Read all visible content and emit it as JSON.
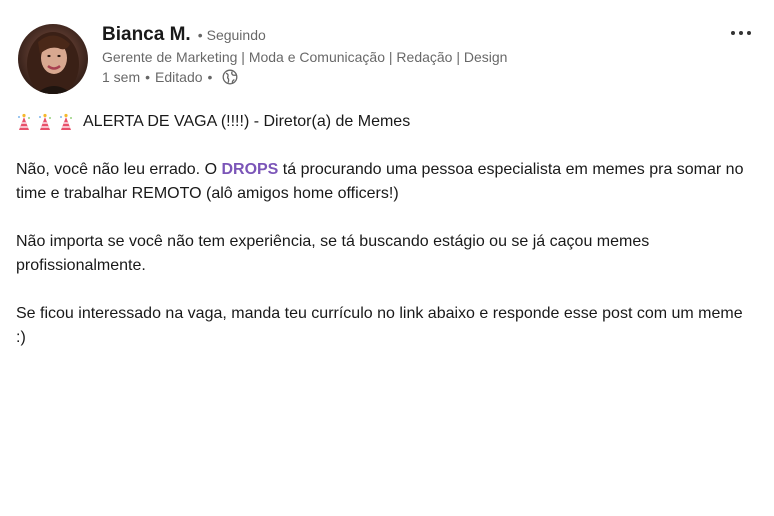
{
  "author": {
    "name": "Bianca M.",
    "follow_separator": "•",
    "follow_status": "Seguindo",
    "headline": "Gerente de Marketing | Moda e Comunicação | Redação | Design",
    "time": "1 sem",
    "edited": "Editado",
    "meta_separator": "•",
    "visibility_icon": "globe-icon"
  },
  "more_label": "•••",
  "post": {
    "title": "ALERTA DE VAGA (!!!!) - Diretor(a) de Memes",
    "title_icons": [
      "party-popper-icon",
      "party-popper-icon",
      "party-popper-icon"
    ],
    "p1_before": "Não, você não leu errado. O ",
    "p1_mention": "DROPS",
    "p1_after": " tá procurando uma pessoa especialista em memes pra somar no time e trabalhar REMOTO (alô amigos home officers!)",
    "p2": "Não importa se você não tem experiência, se tá buscando estágio ou se já caçou memes profissionalmente.",
    "p3": "Se ficou interessado na vaga, manda teu currículo no link abaixo e responde esse post com um meme :)"
  },
  "colors": {
    "mention": "#7b55b8",
    "secondary_text": "#666666",
    "primary_text": "#191919"
  }
}
